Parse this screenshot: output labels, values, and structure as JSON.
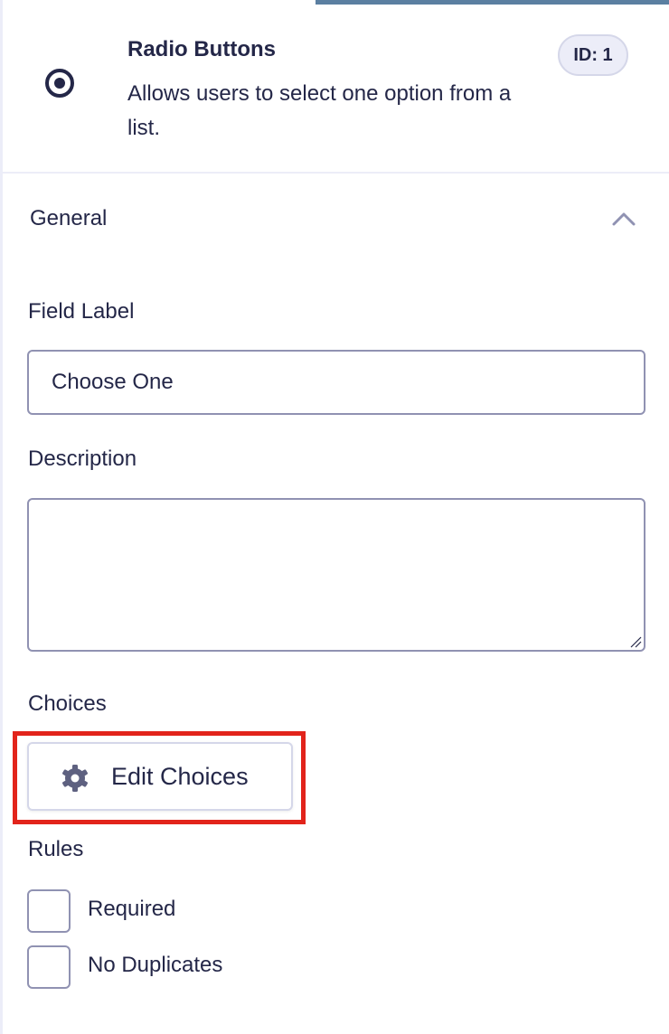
{
  "field": {
    "title": "Radio Buttons",
    "description": "Allows users to select one option from a list.",
    "id_badge": "ID: 1",
    "icon": "radio-button-icon"
  },
  "section": {
    "title": "General",
    "expanded": true
  },
  "field_label": {
    "label": "Field Label",
    "value": "Choose One"
  },
  "description": {
    "label": "Description",
    "value": ""
  },
  "choices": {
    "label": "Choices",
    "button_label": "Edit Choices",
    "button_icon": "gear-icon"
  },
  "rules": {
    "label": "Rules",
    "options": [
      {
        "label": "Required",
        "checked": false
      },
      {
        "label": "No Duplicates",
        "checked": false
      }
    ]
  },
  "colors": {
    "text": "#242748",
    "border": "#9092b2",
    "tab_indicator": "#5b7fa1",
    "highlight": "#e2241b",
    "badge_bg": "#ecedf8"
  }
}
